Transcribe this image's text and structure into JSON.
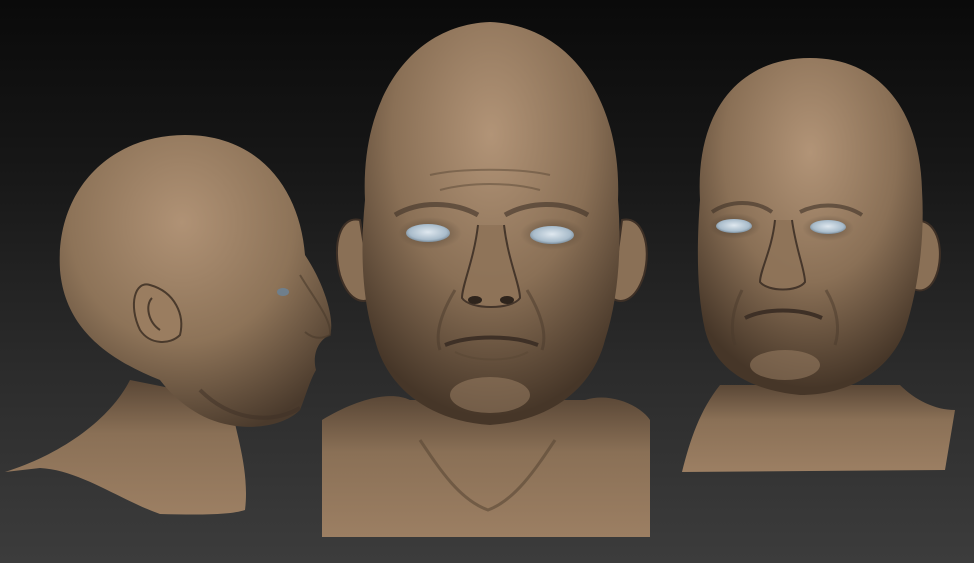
{
  "scene": {
    "background_top": "#0a0a0a",
    "background_bottom": "#3c3c3c",
    "skin_base": "#8d7358",
    "skin_highlight": "#b09275",
    "skin_shadow": "#3e3026",
    "eye_color": "#a9bccb"
  },
  "views": [
    {
      "view": "three-quarter-back-left"
    },
    {
      "view": "front"
    },
    {
      "view": "three-quarter-front-right"
    }
  ]
}
